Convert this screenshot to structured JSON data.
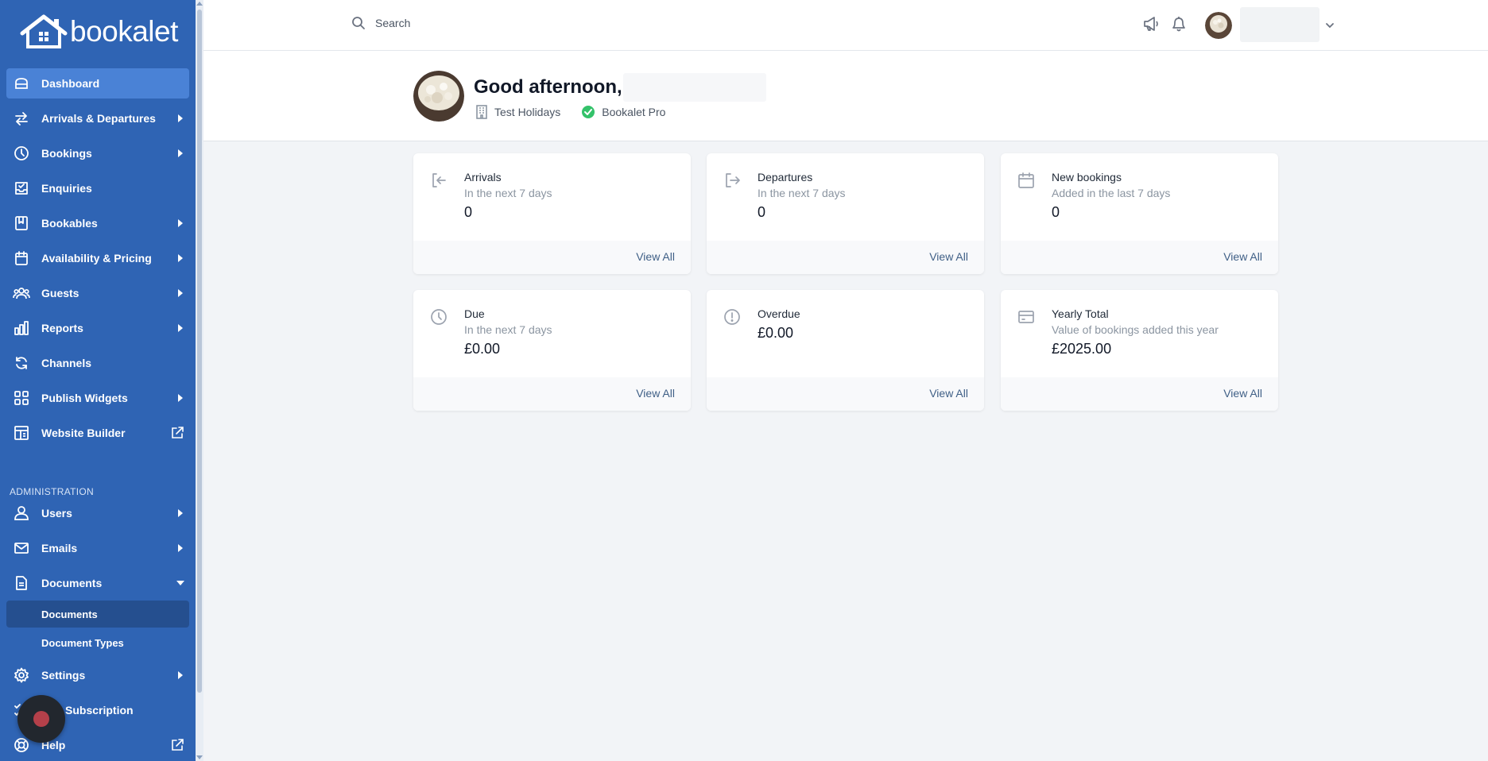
{
  "brand": {
    "name": "bookalet"
  },
  "sidebar": {
    "items": [
      {
        "label": "Dashboard"
      },
      {
        "label": "Arrivals & Departures"
      },
      {
        "label": "Bookings"
      },
      {
        "label": "Enquiries"
      },
      {
        "label": "Bookables"
      },
      {
        "label": "Availability & Pricing"
      },
      {
        "label": "Guests"
      },
      {
        "label": "Reports"
      },
      {
        "label": "Channels"
      },
      {
        "label": "Publish Widgets"
      },
      {
        "label": "Website Builder"
      }
    ],
    "admin_heading": "ADMINISTRATION",
    "admin_items": [
      {
        "label": "Users"
      },
      {
        "label": "Emails"
      },
      {
        "label": "Documents"
      },
      {
        "label": "Settings"
      },
      {
        "label": "Subscription"
      },
      {
        "label": "Help"
      }
    ],
    "sub_items": [
      {
        "label": "Documents"
      },
      {
        "label": "Document Types"
      }
    ]
  },
  "search": {
    "placeholder": "Search"
  },
  "header": {
    "greeting": "Good afternoon,",
    "company": "Test Holidays",
    "plan": "Bookalet Pro"
  },
  "cards": [
    {
      "title": "Arrivals",
      "subtitle": "In the next 7 days",
      "value": "0",
      "link": "View All"
    },
    {
      "title": "Departures",
      "subtitle": "In the next 7 days",
      "value": "0",
      "link": "View All"
    },
    {
      "title": "New bookings",
      "subtitle": "Added in the last 7 days",
      "value": "0",
      "link": "View All"
    },
    {
      "title": "Due",
      "subtitle": "In the next 7 days",
      "value": "£0.00",
      "link": "View All"
    },
    {
      "title": "Overdue",
      "subtitle": "",
      "value": "£0.00",
      "link": "View All"
    },
    {
      "title": "Yearly Total",
      "subtitle": "Value of bookings added this year",
      "value": "£2025.00",
      "link": "View All"
    }
  ],
  "colors": {
    "sidebar": "#2f64b4",
    "active": "#4a82d6",
    "link": "#3f5f86",
    "success": "#34c26a"
  }
}
